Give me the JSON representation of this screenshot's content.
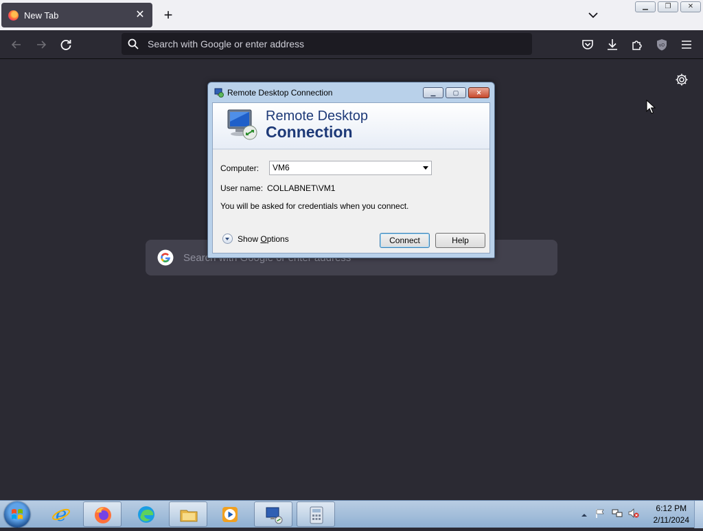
{
  "browser": {
    "tab_title": "New Tab",
    "close_glyph": "✕",
    "new_tab_glyph": "+",
    "url_placeholder": "Search with Google or enter address",
    "ntp_search_placeholder": "Search with Google or enter address"
  },
  "dialog": {
    "title": "Remote Desktop Connection",
    "banner_line1": "Remote Desktop",
    "banner_line2": "Connection",
    "computer_label": "Computer:",
    "computer_value": "VM6",
    "username_label": "User name:",
    "username_value": "COLLABNET\\VM1",
    "info_text": "You will be asked for credentials when you connect.",
    "show_options_prefix": "Show ",
    "show_options_accel": "O",
    "show_options_suffix": "ptions",
    "connect_label": "Connect",
    "help_label": "Help"
  },
  "taskbar": {
    "time": "6:12 PM",
    "date": "2/11/2024",
    "pinned": [
      "internet-explorer",
      "firefox",
      "edge",
      "file-explorer",
      "media-player",
      "remote-desktop",
      "calculator"
    ]
  }
}
